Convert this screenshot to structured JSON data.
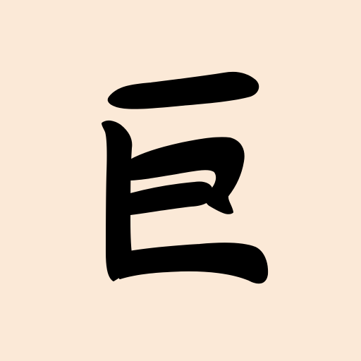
{
  "app_icon": {
    "character": "巨",
    "icon_name": "ju-calligraphy-icon",
    "colors": {
      "background": "#fbe9d7",
      "ink": "#000000"
    }
  }
}
